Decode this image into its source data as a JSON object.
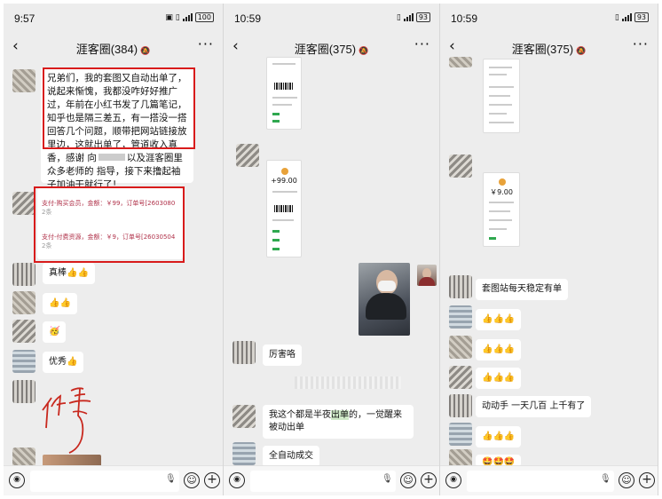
{
  "screen1": {
    "time": "9:57",
    "battery": "100",
    "title": "涯客圈(384)",
    "message_main": "兄弟们，我的套图又自动出单了，说起来惭愧，我都没咋好好推广过，年前在小红书发了几篇笔记，知乎也是隔三差五，有一搭没一搭回答几个问题，顺带把网站链接放里边，这就出单了，管道收入真香，感谢",
    "message_tail_1": "向",
    "message_tail_2": "以及涯客圈里众多老师的",
    "message_tail_3": "指导，接下来撸起袖子加油干就行了！",
    "order_1": "支付-购买会员，金额：￥99，订单号[2603080",
    "order_1_sub": "2条",
    "order_2": "支付-付费资源，金额：￥9，订单号[26030504",
    "order_2_sub": "2条",
    "reply_1": "真棒👍👍",
    "reply_2": "👍👍",
    "reply_3": "🥳",
    "reply_4": "优秀👍"
  },
  "screen2": {
    "time": "10:59",
    "battery": "93",
    "title": "涯客圈(375)",
    "shot_amount": "+99.00",
    "msg_1": "厉害咯",
    "msg_2_pre": "我这个都是半夜",
    "msg_2_hl": "出单",
    "msg_2_post": "的，一觉醒来被动出单",
    "msg_3": "全自动成交"
  },
  "screen3": {
    "time": "10:59",
    "battery": "93",
    "title": "涯客圈(375)",
    "shot_amount": "￥9.00",
    "msg_1": "套图站每天稳定有单",
    "msg_2": "👍👍👍",
    "msg_3": "👍👍👍",
    "msg_4": "👍👍👍",
    "msg_5": "动动手 一天几百 上千有了",
    "msg_6": "👍👍👍",
    "msg_7": "🤩🤩🤩"
  },
  "colors": {
    "highlight_box": "#d81b1b",
    "background": "#ededed",
    "bubble": "#ffffff"
  },
  "icons": [
    "back-arrow-icon",
    "more-icon",
    "mute-icon",
    "voice-icon",
    "mic-icon",
    "emoji-icon",
    "plus-icon",
    "signal-icon",
    "battery-icon"
  ]
}
